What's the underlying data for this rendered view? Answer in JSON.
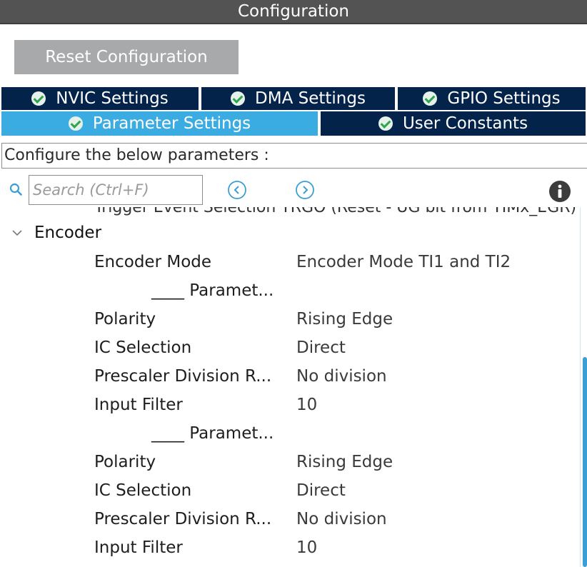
{
  "window": {
    "title": "Configuration"
  },
  "toolbar": {
    "reset_label": "Reset Configuration"
  },
  "tabs": {
    "nvic": "NVIC Settings",
    "dma": "DMA Settings",
    "gpio": "GPIO Settings",
    "param": "Parameter Settings",
    "user": "User Constants",
    "active": "Parameter Settings"
  },
  "description": "Configure the below parameters :",
  "search": {
    "placeholder": "Search (Ctrl+F)",
    "value": ""
  },
  "tree": {
    "cut_off_row": "Trigger Event Selection TRGO (Reset - UG bit from TIMx_EGR)",
    "group": "Encoder",
    "encoder_mode": {
      "name": "Encoder Mode",
      "value": "Encoder Mode TI1 and TI2"
    },
    "channel1": {
      "header": "____ Paramet...",
      "polarity": {
        "name": "Polarity",
        "value": "Rising Edge"
      },
      "ic_selection": {
        "name": "IC Selection",
        "value": "Direct"
      },
      "prescaler": {
        "name": "Prescaler Division R...",
        "value": "No division"
      },
      "input_filter": {
        "name": "Input Filter",
        "value": "10"
      }
    },
    "channel2": {
      "header": "____ Paramet...",
      "polarity": {
        "name": "Polarity",
        "value": "Rising Edge"
      },
      "ic_selection": {
        "name": "IC Selection",
        "value": "Direct"
      },
      "prescaler": {
        "name": "Prescaler Division R...",
        "value": "No division"
      },
      "input_filter": {
        "name": "Input Filter",
        "value": "10"
      }
    }
  },
  "colors": {
    "title_bar": "#535353",
    "tab_inactive": "#03234b",
    "tab_active": "#3bace2",
    "reset_button": "#a8a9aa",
    "check_green": "#2fa44f",
    "nav_blue": "#3b9fd6"
  }
}
